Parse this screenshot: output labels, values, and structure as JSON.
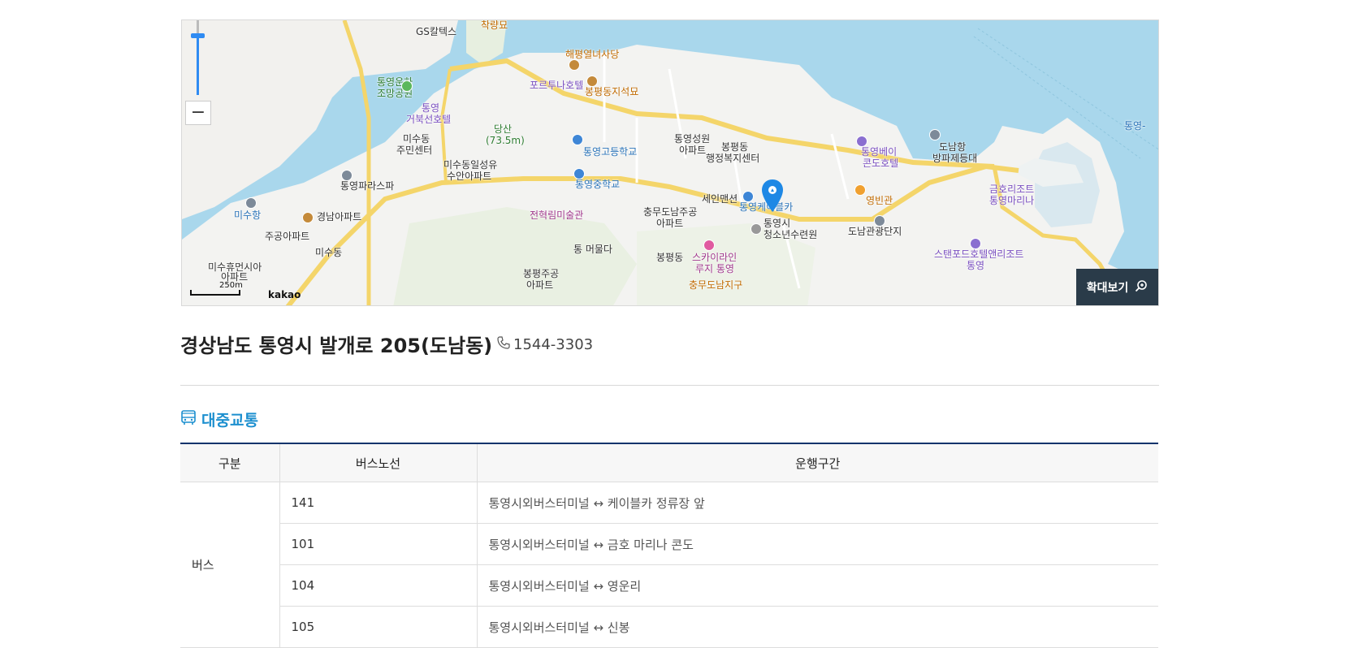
{
  "map": {
    "enlarge_label": "확대보기",
    "zoom_out_label": "−",
    "scale_label": "250m",
    "provider": "kakao",
    "labels": [
      {
        "text": "GS칼텍스",
        "cls": ""
      },
      {
        "text": "착량묘",
        "cls": "o"
      },
      {
        "text": "해평열녀사당",
        "cls": "o"
      },
      {
        "text": "포르투나호텔",
        "cls": "p"
      },
      {
        "text": "봉평동지석묘",
        "cls": "o"
      },
      {
        "text": "통영운하",
        "cls": "g"
      },
      {
        "text": "조망공원",
        "cls": "g"
      },
      {
        "text": "통영",
        "cls": "p"
      },
      {
        "text": "거북선호텔",
        "cls": "p"
      },
      {
        "text": "당산",
        "cls": "g"
      },
      {
        "text": "(73.5m)",
        "cls": "g"
      },
      {
        "text": "미수동",
        "cls": ""
      },
      {
        "text": "주민센터",
        "cls": ""
      },
      {
        "text": "미수동일성유",
        "cls": ""
      },
      {
        "text": "수안아파트",
        "cls": ""
      },
      {
        "text": "통영고등학교",
        "cls": "b"
      },
      {
        "text": "통영성원",
        "cls": ""
      },
      {
        "text": "아파트",
        "cls": ""
      },
      {
        "text": "봉평동",
        "cls": ""
      },
      {
        "text": "행정복지센터",
        "cls": ""
      },
      {
        "text": "통영베이",
        "cls": "p"
      },
      {
        "text": "콘도호텔",
        "cls": "p"
      },
      {
        "text": "도남항",
        "cls": ""
      },
      {
        "text": "방파제등대",
        "cls": ""
      },
      {
        "text": "통영파라스파",
        "cls": ""
      },
      {
        "text": "통영중학교",
        "cls": "b"
      },
      {
        "text": "세인맨션",
        "cls": ""
      },
      {
        "text": "통영케이블카",
        "cls": "b"
      },
      {
        "text": "영빈관",
        "cls": "o"
      },
      {
        "text": "금호리조트",
        "cls": "p"
      },
      {
        "text": "통영마리나",
        "cls": "p"
      },
      {
        "text": "미수항",
        "cls": "b"
      },
      {
        "text": "경남아파트",
        "cls": ""
      },
      {
        "text": "전혁림미술관",
        "cls": "m"
      },
      {
        "text": "충무도남주공",
        "cls": ""
      },
      {
        "text": "아파트",
        "cls": ""
      },
      {
        "text": "통영시",
        "cls": ""
      },
      {
        "text": "청소년수련원",
        "cls": ""
      },
      {
        "text": "도남관광단지",
        "cls": ""
      },
      {
        "text": "주공아파트",
        "cls": ""
      },
      {
        "text": "통 머물다",
        "cls": ""
      },
      {
        "text": "미수동",
        "cls": ""
      },
      {
        "text": "봉평동",
        "cls": ""
      },
      {
        "text": "스카이라인",
        "cls": "m"
      },
      {
        "text": "루지 통영",
        "cls": "m"
      },
      {
        "text": "스탠포드호텔앤리조트",
        "cls": "p"
      },
      {
        "text": "통영",
        "cls": "p"
      },
      {
        "text": "미수휴먼시아",
        "cls": ""
      },
      {
        "text": "아파트",
        "cls": ""
      },
      {
        "text": "봉평주공",
        "cls": ""
      },
      {
        "text": "아파트",
        "cls": ""
      },
      {
        "text": "충무도남지구",
        "cls": "o"
      },
      {
        "text": "통영-",
        "cls": "b"
      }
    ]
  },
  "address": "경상남도 통영시 발개로 205(도남동)",
  "phone": "1544-3303",
  "transit": {
    "title": "대중교통",
    "headers": [
      "구분",
      "버스노선",
      "운행구간"
    ],
    "category": "버스",
    "rows": [
      {
        "route": "141",
        "section": "통영시외버스터미널 ↔ 케이블카 정류장 앞"
      },
      {
        "route": "101",
        "section": "통영시외버스터미널 ↔ 금호 마리나 콘도"
      },
      {
        "route": "104",
        "section": "통영시외버스터미널 ↔ 영운리"
      },
      {
        "route": "105",
        "section": "통영시외버스터미널 ↔ 신봉"
      }
    ]
  },
  "colors": {
    "accent": "#1c8fcf",
    "table_border": "#10346b",
    "map_button": "#2a3b49",
    "sea": "#a9d7ec",
    "land": "#f3f3f1",
    "road": "#f6d96b"
  }
}
